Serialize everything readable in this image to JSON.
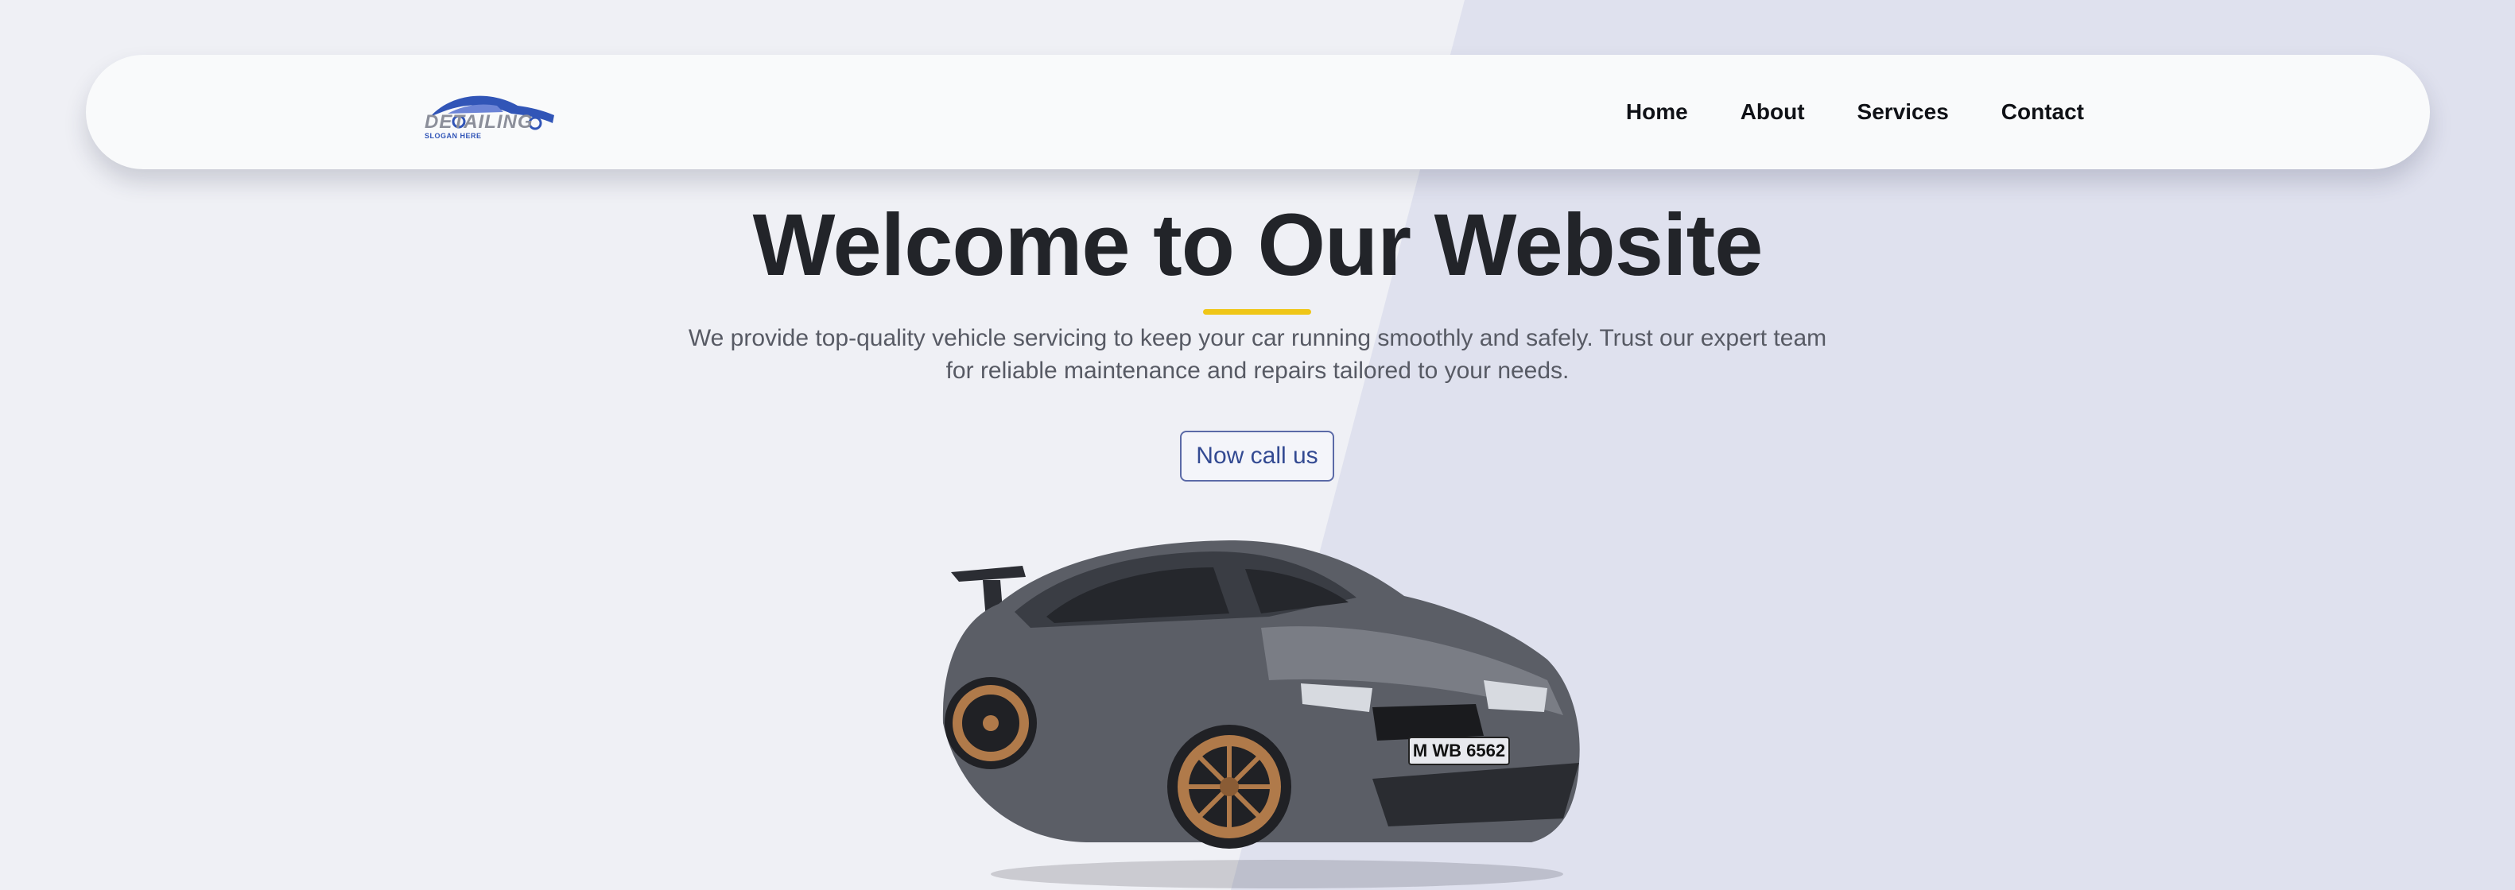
{
  "brand": {
    "name": "DETAILING",
    "slogan": "SLOGAN HERE"
  },
  "nav": {
    "items": [
      {
        "label": "Home"
      },
      {
        "label": "About"
      },
      {
        "label": "Services"
      },
      {
        "label": "Contact"
      }
    ]
  },
  "hero": {
    "title": "Welcome to Our Website",
    "description": "We provide top-quality vehicle servicing to keep your car running smoothly and safely. Trust our expert team for reliable maintenance and repairs tailored to your needs.",
    "cta_label": "Now call us"
  },
  "car": {
    "plate": "M WB 6562"
  },
  "colors": {
    "background": "#eff0f5",
    "diagonal": "#dfe1ee",
    "navbar": "#f9fafb",
    "accent_yellow": "#efc617",
    "cta_blue": "#334a92",
    "title": "#222429",
    "logo_blue": "#3155b7"
  }
}
